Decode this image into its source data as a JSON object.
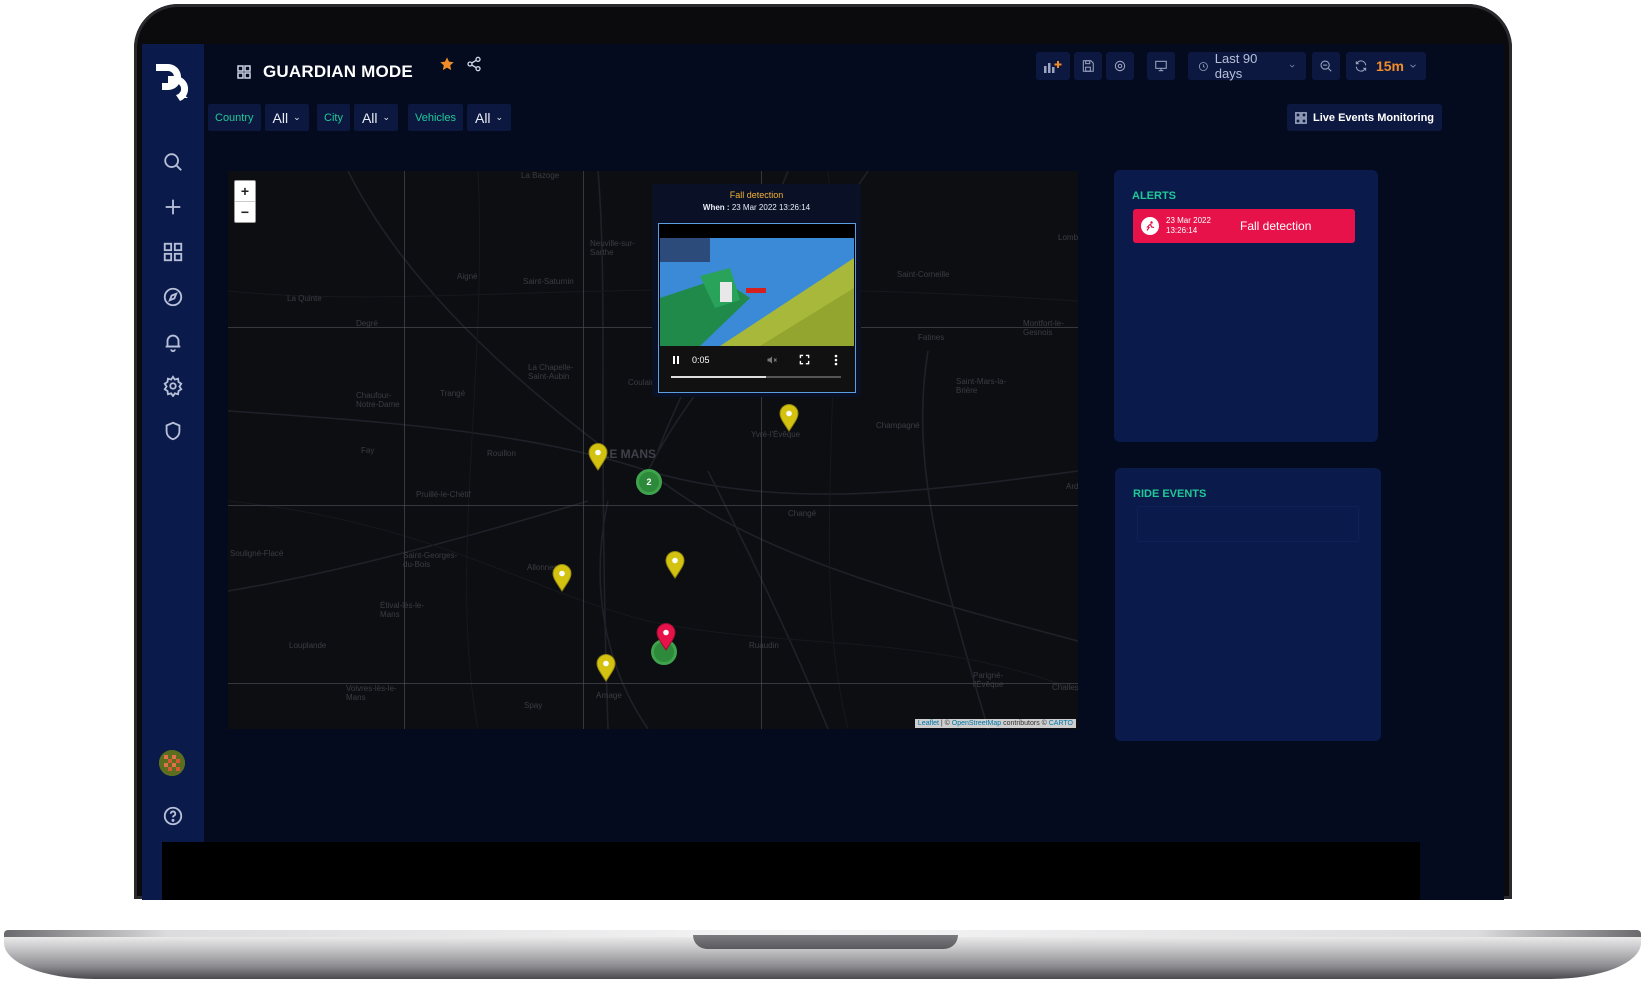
{
  "app": {
    "title": "GUARDIAN MODE"
  },
  "toolbar": {
    "time_range": "Last 90 days",
    "refresh_interval": "15m",
    "accent_color": "#f28c28"
  },
  "filters": [
    {
      "label": "Country",
      "value": "All"
    },
    {
      "label": "City",
      "value": "All"
    },
    {
      "label": "Vehicles",
      "value": "All"
    }
  ],
  "live_monitoring": {
    "label": "Live Events Monitoring"
  },
  "map": {
    "zoom_in": "+",
    "zoom_out": "−",
    "city_label": "LE MANS",
    "cluster_counts": [
      "2",
      ""
    ],
    "attribution": {
      "leaflet": "Leaflet",
      "sep1": " | © ",
      "osm": "OpenStreetMap",
      "contrib": " contributors © ",
      "carto": "CARTO"
    },
    "towns": [
      "La Bazoge",
      "Neuville-sur-Sarthe",
      "Aigné",
      "Saint-Saturnin",
      "La Quinte",
      "Degré",
      "Saint-Corneille",
      "Lombron",
      "Montfort-le-Gesnois",
      "Fatines",
      "La Chapelle-Saint-Aubin",
      "Trangé",
      "Chaufour-Notre-Dame",
      "Coulaines",
      "Yvré-l'Évêque",
      "Saint-Mars-la-Brière",
      "Champagné",
      "Pruillé-le-Chétif",
      "Fay",
      "Rouillon",
      "Changé",
      "Ardenay",
      "Souligné-Flacé",
      "Saint-Georges-du-Bois",
      "Allonnes",
      "Étival-lès-le-Mans",
      "Louplande",
      "Voivres-lès-le-Mans",
      "Spay",
      "Arnage",
      "Ruaudin",
      "Parigné-l'Évêque",
      "Challes"
    ]
  },
  "popup": {
    "title": "Fall detection",
    "when_label": "When :",
    "when_value": "23 Mar 2022 13:26:14",
    "video_time": "0:05",
    "video_progress": 0.56
  },
  "alerts": {
    "title": "ALERTS",
    "items": [
      {
        "date_line1": "23 Mar 2022",
        "date_line2": "13:26:14",
        "name": "Fall detection",
        "color": "#e8124b"
      }
    ]
  },
  "ride_events": {
    "title": "RIDE EVENTS"
  }
}
